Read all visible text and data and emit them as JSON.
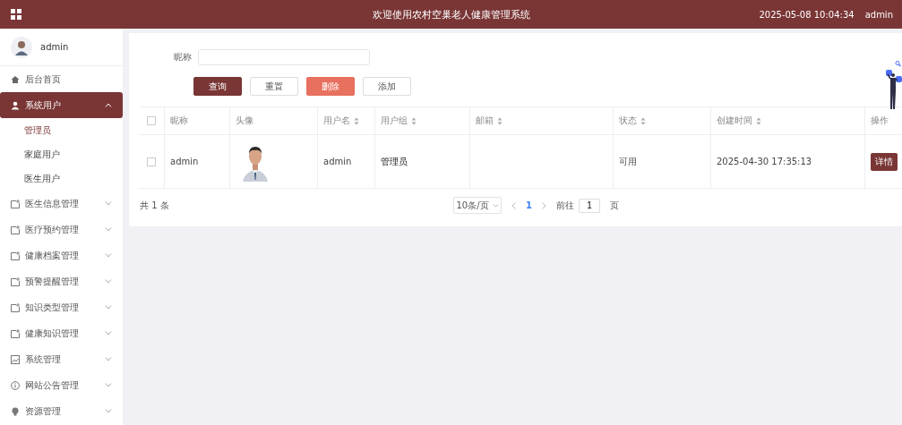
{
  "header": {
    "title": "欢迎使用农村空巢老人健康管理系统",
    "datetime": "2025-05-08 10:04:34",
    "user": "admin"
  },
  "sidebar": {
    "user": "admin",
    "items": [
      {
        "label": "后台首页",
        "selected": false
      },
      {
        "label": "系统用户",
        "selected": true,
        "expanded": true,
        "children": [
          {
            "label": "管理员",
            "selected": true
          },
          {
            "label": "家庭用户",
            "selected": false
          },
          {
            "label": "医生用户",
            "selected": false
          }
        ]
      },
      {
        "label": "医生信息管理",
        "selected": false,
        "expanded": false
      },
      {
        "label": "医疗预约管理",
        "selected": false,
        "expanded": false
      },
      {
        "label": "健康档案管理",
        "selected": false,
        "expanded": false
      },
      {
        "label": "预警提醒管理",
        "selected": false,
        "expanded": false
      },
      {
        "label": "知识类型管理",
        "selected": false,
        "expanded": false
      },
      {
        "label": "健康知识管理",
        "selected": false,
        "expanded": false
      },
      {
        "label": "系统管理",
        "selected": false,
        "expanded": false
      },
      {
        "label": "网站公告管理",
        "selected": false,
        "expanded": false
      },
      {
        "label": "资源管理",
        "selected": false,
        "expanded": false
      }
    ]
  },
  "search": {
    "label": "昵称",
    "buttons": [
      {
        "label": "查询",
        "kind": "primary"
      },
      {
        "label": "重置",
        "kind": "plain"
      },
      {
        "label": "删除",
        "kind": "danger"
      },
      {
        "label": "添加",
        "kind": "plain"
      }
    ]
  },
  "table": {
    "all_checked": false,
    "columns": [
      {
        "label": "昵称",
        "sortable": false
      },
      {
        "label": "头像",
        "sortable": false
      },
      {
        "label": "用户名",
        "sortable": true
      },
      {
        "label": "用户组",
        "sortable": true
      },
      {
        "label": "邮箱",
        "sortable": true
      },
      {
        "label": "状态",
        "sortable": true
      },
      {
        "label": "创建时间",
        "sortable": true
      },
      {
        "label": "操作",
        "sortable": false
      }
    ],
    "rows": [
      {
        "checked": false,
        "nickname": "admin",
        "username": "admin",
        "group": "管理员",
        "email": "",
        "status": "可用",
        "created": "2025-04-30 17:35:13",
        "action": "详情"
      }
    ]
  },
  "pagination": {
    "total": "共 1 条",
    "page_size": "10条/页",
    "pages": [
      {
        "label": "1",
        "selected": true
      }
    ],
    "goto_label": "前往",
    "goto_value": "1",
    "goto_suffix": "页"
  }
}
